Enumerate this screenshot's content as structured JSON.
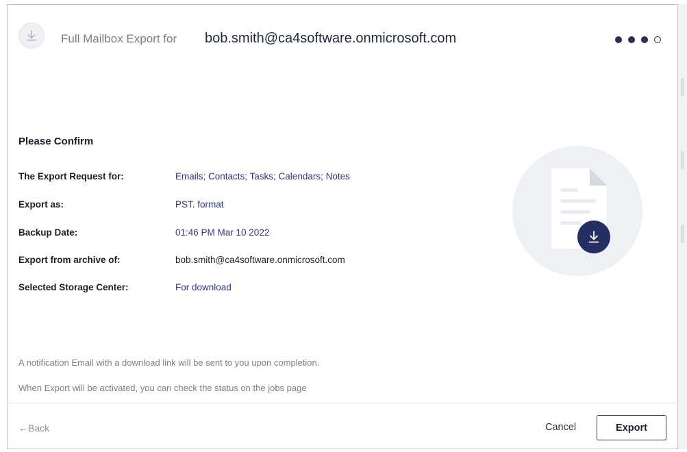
{
  "header": {
    "title_prefix": "Full Mailbox Export for",
    "email": "bob.smith@ca4software.onmicrosoft.com",
    "steps": {
      "total": 4,
      "completed": 3
    }
  },
  "confirm": {
    "title": "Please Confirm",
    "rows": [
      {
        "label": "The Export Request for:",
        "value": "Emails; Contacts; Tasks; Calendars; Notes"
      },
      {
        "label": "Export as:",
        "value": "PST. format"
      },
      {
        "label": "Backup Date:",
        "value": "01:46 PM Mar 10 2022"
      },
      {
        "label": "Export from archive of:",
        "value": "bob.smith@ca4software.onmicrosoft.com"
      },
      {
        "label": "Selected Storage Center:",
        "value": "For download"
      }
    ]
  },
  "notes": {
    "notification": "A notification Email with a download link will be sent to you upon completion.",
    "status": "When Export will be activated, you can check the status on the jobs page"
  },
  "footer": {
    "back_label": "←Back",
    "cancel_label": "Cancel",
    "export_label": "Export"
  },
  "icons": {
    "header": "download-icon",
    "illustration": "document-download-icon"
  },
  "colors": {
    "accent": "#262f63",
    "link": "#2f3781",
    "muted": "#7b7f8a"
  }
}
